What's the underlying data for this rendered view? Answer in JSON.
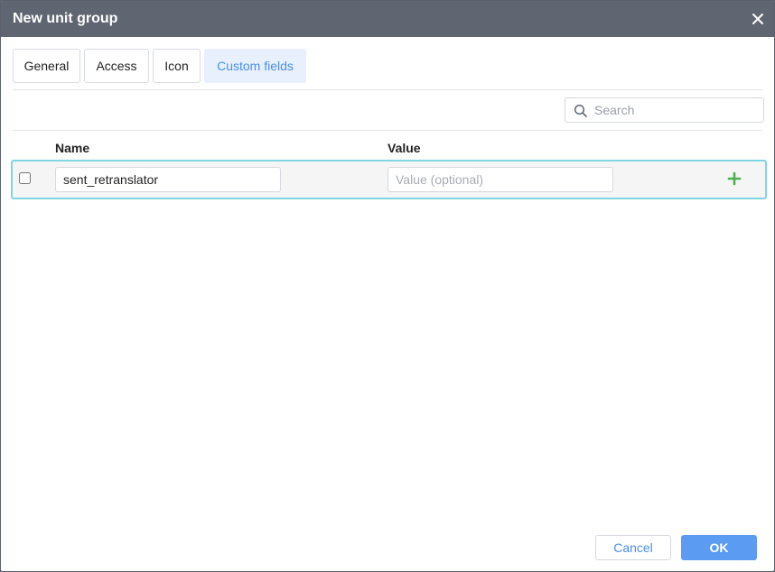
{
  "dialog": {
    "title": "New unit group",
    "close_icon": "close-icon"
  },
  "tabs": [
    {
      "label": "General",
      "active": false
    },
    {
      "label": "Access",
      "active": false
    },
    {
      "label": "Icon",
      "active": false
    },
    {
      "label": "Custom fields",
      "active": true
    }
  ],
  "search": {
    "placeholder": "Search",
    "value": "",
    "icon": "search-icon"
  },
  "table": {
    "columns": {
      "name": "Name",
      "value": "Value"
    },
    "new_row": {
      "checked": false,
      "name_value": "sent_retranslator",
      "value_value": "",
      "value_placeholder": "Value (optional)",
      "add_icon": "plus-icon"
    }
  },
  "footer": {
    "cancel_label": "Cancel",
    "ok_label": "OK"
  },
  "colors": {
    "titlebar": "#5f6672",
    "accent": "#4a8ff0",
    "ok_button": "#5b9cf2",
    "active_tab_bg": "#e8f0fd",
    "row_highlight_border": "#7fd6e0",
    "add_icon": "#4caf50"
  }
}
